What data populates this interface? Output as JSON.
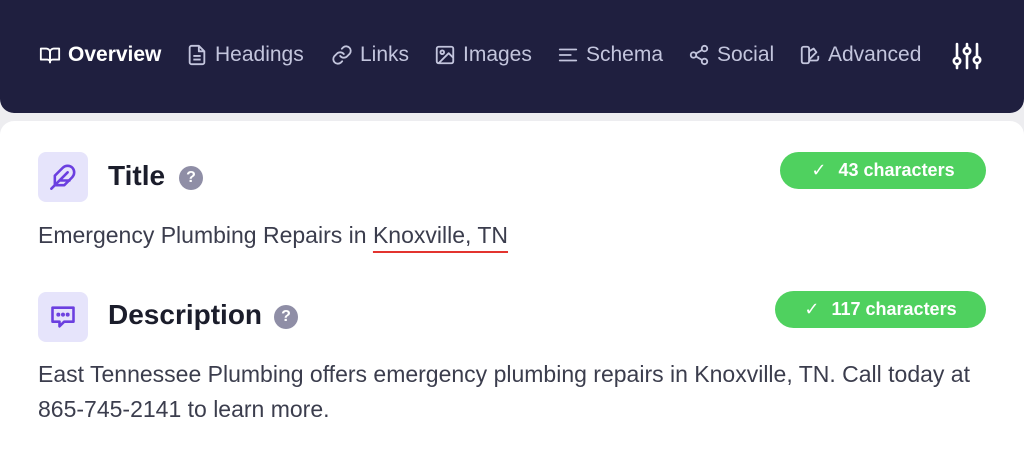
{
  "nav": {
    "tabs": [
      {
        "label": "Overview",
        "icon": "book-open-icon",
        "active": true
      },
      {
        "label": "Headings",
        "icon": "document-icon",
        "active": false
      },
      {
        "label": "Links",
        "icon": "link-icon",
        "active": false
      },
      {
        "label": "Images",
        "icon": "image-icon",
        "active": false
      },
      {
        "label": "Schema",
        "icon": "schema-lines-icon",
        "active": false
      },
      {
        "label": "Social",
        "icon": "share-icon",
        "active": false
      },
      {
        "label": "Advanced",
        "icon": "advanced-icon",
        "active": false
      }
    ],
    "settings_icon": "sliders-icon"
  },
  "title_section": {
    "heading": "Title",
    "help": "?",
    "badge_check": "✓",
    "badge_text": "43 characters",
    "text_prefix": "Emergency Plumbing Repairs in ",
    "text_flagged": "Knoxville, TN",
    "icon": "feather-icon"
  },
  "description_section": {
    "heading": "Description",
    "help": "?",
    "badge_check": "✓",
    "badge_text": "117 characters",
    "text": "East Tennessee Plumbing offers emergency plumbing repairs in Knoxville, TN. Call today at 865-745-2141 to learn more.",
    "icon": "chat-icon"
  },
  "colors": {
    "nav_bg": "#1f1f3f",
    "badge_green": "#4fd15f",
    "accent_purple": "#6b3fe0",
    "flag_red": "#e3342f"
  }
}
